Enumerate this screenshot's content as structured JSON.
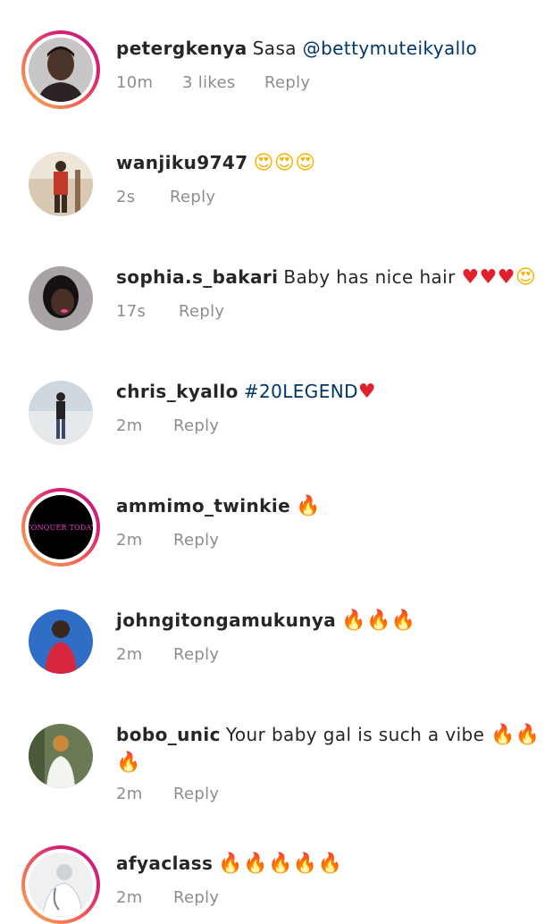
{
  "comments": [
    {
      "username": "petergkenya",
      "text": "Sasa ",
      "mention": "@bettymuteikyallo",
      "time": "10m",
      "likes": "3 likes",
      "reply": "Reply",
      "story_ring": true
    },
    {
      "username": "wanjiku9747",
      "emoji": "😍😍😍",
      "time": "2s",
      "reply": "Reply",
      "story_ring": false
    },
    {
      "username": "sophia.s_bakari",
      "text": "Baby has nice hair ",
      "emoji_hearts": "♥♥♥",
      "emoji": "😍",
      "time": "17s",
      "reply": "Reply",
      "story_ring": false
    },
    {
      "username": "chris_kyallo",
      "hashtag": "#20LEGEND",
      "emoji_hearts": "♥",
      "time": "2m",
      "reply": "Reply",
      "story_ring": false
    },
    {
      "username": "ammimo_twinkie",
      "emoji_fire": "🔥",
      "time": "2m",
      "reply": "Reply",
      "story_ring": true,
      "avatar_text": "CONQUER TODAY"
    },
    {
      "username": "johngitongamukunya",
      "emoji_fire": "🔥🔥🔥",
      "time": "2m",
      "reply": "Reply",
      "story_ring": false
    },
    {
      "username": "bobo_unic",
      "text": "Your baby gal is such a vibe ",
      "emoji_fire": "🔥🔥🔥",
      "time": "2m",
      "reply": "Reply",
      "story_ring": false
    },
    {
      "username": "afyaclass",
      "emoji_fire": "🔥🔥🔥🔥🔥",
      "time": "2m",
      "reply": "Reply",
      "story_ring": true
    }
  ]
}
